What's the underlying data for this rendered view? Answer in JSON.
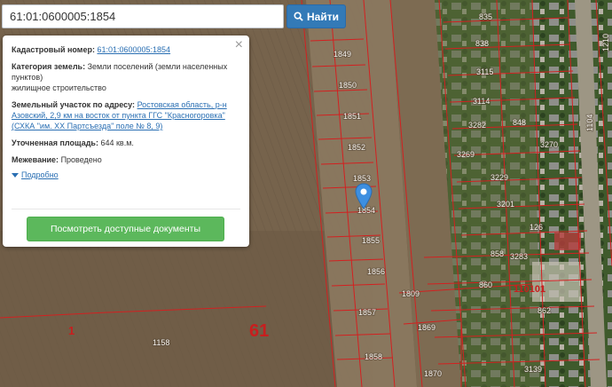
{
  "search": {
    "value": "61:01:0600005:1854",
    "button_label": "Найти"
  },
  "panel": {
    "cadastral_label": "Кадастровый номер:",
    "cadastral_value": "61:01:0600005:1854",
    "category_label": "Категория земель:",
    "category_value": "Земли поселений (земли населенных пунктов)",
    "category_use": "жилищное строительство",
    "address_label": "Земельный участок по адресу:",
    "address_value": "Ростовская область, р-н Азовский, 2,9 км на восток от пункта ГГС \"Красногоровка\" (СХКА \"им. XX Партсъезда\" поле № 8, 9)",
    "area_label": "Уточненная площадь:",
    "area_value": "644 кв.м.",
    "survey_label": "Межевание:",
    "survey_value": "Проведено",
    "more_label": "Подробно",
    "docs_button": "Посмотреть доступные документы"
  },
  "map": {
    "plot_numbers": [
      "1849",
      "1850",
      "1851",
      "1852",
      "1853",
      "1854",
      "1855",
      "1856",
      "1857",
      "1858",
      "1158",
      "1809",
      "1869",
      "1870",
      "835",
      "838",
      "3115",
      "3114",
      "3282",
      "848",
      "3270",
      "3269",
      "3229",
      "3201",
      "126",
      "858",
      "3283",
      "860",
      "862",
      "3139"
    ],
    "big_region_label": "61",
    "side_label": "1",
    "quarter_label": "110101",
    "road_labels": [
      "1210",
      "1104"
    ],
    "colors": {
      "boundary": "#d32020",
      "marker": "#3d8fe0",
      "docs_button": "#5cb85c",
      "search_button": "#337ab7"
    }
  }
}
